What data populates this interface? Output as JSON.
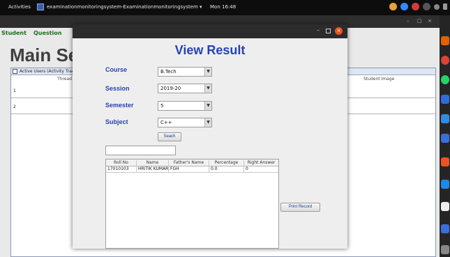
{
  "topbar": {
    "activities": "Activities",
    "app_name": "examinationmonitoringsystem-Examinationmonitoringsystem ▾",
    "clock": "Mon 16:48"
  },
  "main_window": {
    "menu": [
      "Student",
      "Question"
    ],
    "title": "Main Se",
    "users_panel": {
      "checkbox_label": "Active Users (Activity Trac",
      "col_thread": "Thread",
      "col_student_image": "Student Image",
      "rows": [
        "1",
        "2"
      ]
    }
  },
  "dialog": {
    "title": "View Result",
    "fields": {
      "course": {
        "label": "Course",
        "value": "B.Tech"
      },
      "session": {
        "label": "Session",
        "value": "2019-20"
      },
      "semester": {
        "label": "Semester",
        "value": "5"
      },
      "subject": {
        "label": "Subject",
        "value": "C++"
      }
    },
    "search_button": "Seach",
    "filter_value": "",
    "table": {
      "headers": [
        "Roll No",
        "Name",
        "Father's Name",
        "Percentage",
        "Right Answer"
      ],
      "rows": [
        [
          "17010103",
          "HRITIK KUMAR",
          "FGH",
          "0.0",
          "0"
        ]
      ]
    },
    "print_button": "Print Record"
  },
  "colors": {
    "accent_blue": "#2442b5",
    "close_button": "#e95420",
    "menu_green": "#1a6f1a"
  }
}
